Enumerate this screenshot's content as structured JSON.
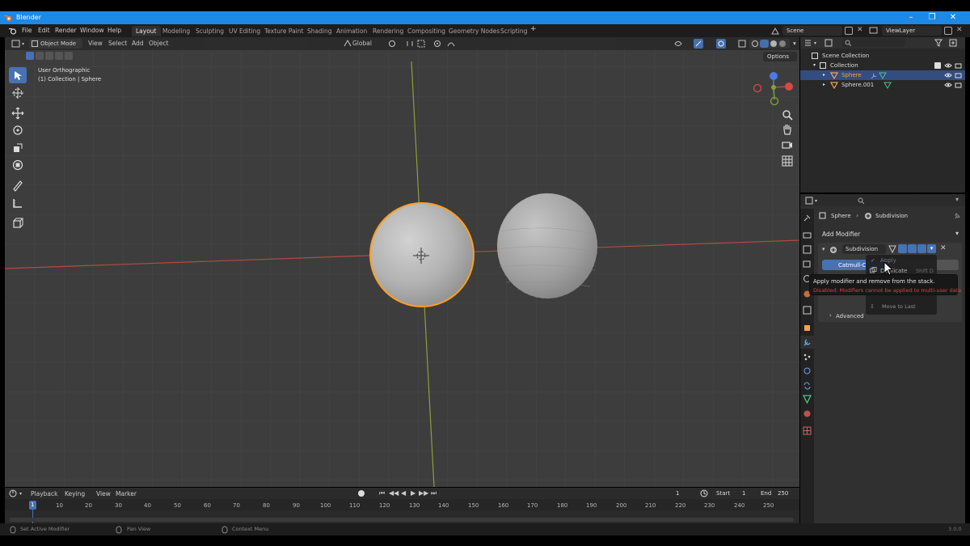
{
  "window": {
    "title": "Blender"
  },
  "menu": [
    "File",
    "Edit",
    "Render",
    "Window",
    "Help"
  ],
  "workspaces": [
    "Layout",
    "Modeling",
    "Sculpting",
    "UV Editing",
    "Texture Paint",
    "Shading",
    "Animation",
    "Rendering",
    "Compositing",
    "Geometry Nodes",
    "Scripting"
  ],
  "workspace_active": "Layout",
  "scene": {
    "name": "Scene",
    "view_layer": "ViewLayer"
  },
  "viewport": {
    "mode": "Object Mode",
    "menus": [
      "View",
      "Select",
      "Add",
      "Object"
    ],
    "transform_orientation": "Global",
    "options_label": "Options",
    "view_name": "User Orthographic",
    "collection_info": "(1) Collection | Sphere"
  },
  "outliner": {
    "root": "Scene Collection",
    "collection": "Collection",
    "objects": [
      "Sphere",
      "Sphere.001"
    ]
  },
  "properties": {
    "breadcrumb_object": "Sphere",
    "breadcrumb_modifier": "Subdivision",
    "add_modifier": "Add Modifier",
    "modifier_name": "Subdivision",
    "subdiv_type": "Catmull-C",
    "simple_label": "Simple",
    "advanced_label": "Advanced"
  },
  "dropdown": {
    "apply": "Apply",
    "duplicate": "Duplicate",
    "shortcut": "Shift D",
    "move_to_last": "Move to Last"
  },
  "tooltip": {
    "line1": "Apply modifier and remove from the stack.",
    "line2": "Disabled: Modifiers cannot be applied to multi-user data"
  },
  "timeline": {
    "menus": [
      "Playback",
      "Keying",
      "View",
      "Marker"
    ],
    "current_frame": "1",
    "start_label": "Start",
    "start": "1",
    "end_label": "End",
    "end": "250",
    "ticks": [
      "10",
      "20",
      "30",
      "40",
      "50",
      "60",
      "70",
      "80",
      "90",
      "100",
      "110",
      "120",
      "130",
      "140",
      "150",
      "160",
      "170",
      "180",
      "190",
      "200",
      "210",
      "220",
      "230",
      "240",
      "250"
    ],
    "playhead": "1"
  },
  "statusbar": {
    "left": "Set Active Modifier",
    "middle": "Pan View",
    "right": "Context Menu",
    "version": "3.0.0"
  },
  "colors": {
    "accent": "#4772b3",
    "selected_outline": "#ff9f1c",
    "x_axis": "#c0403a",
    "y_axis": "#8aa03a",
    "title_bar": "#1e88e5",
    "error_text": "#e04040"
  }
}
